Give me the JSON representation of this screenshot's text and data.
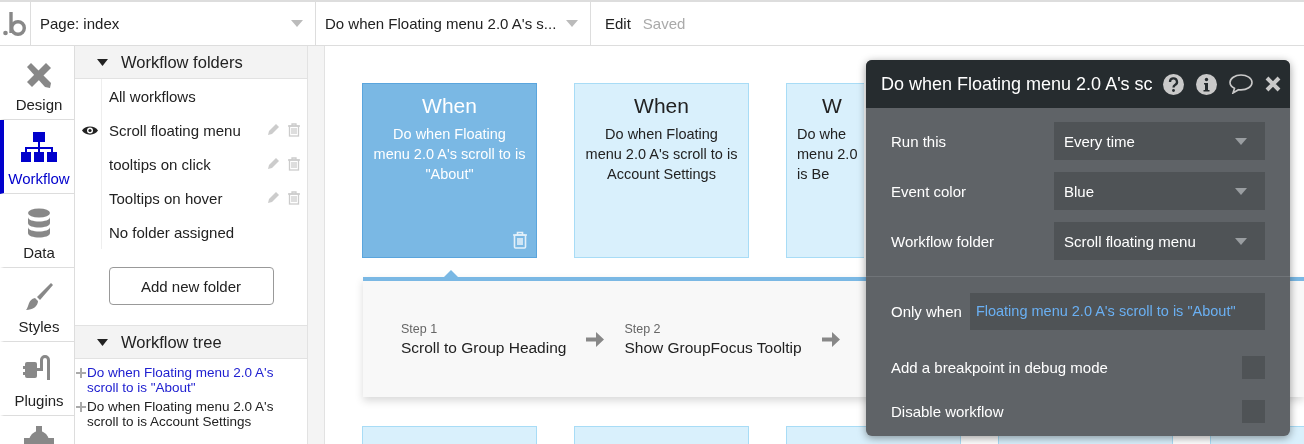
{
  "topbar": {
    "page_select": "Page: index",
    "workflow_select": "Do when Floating menu 2.0 A's s...",
    "edit": "Edit",
    "status": "Saved"
  },
  "nav": [
    {
      "label": "Design",
      "selected": false
    },
    {
      "label": "Workflow",
      "selected": true
    },
    {
      "label": "Data",
      "selected": false
    },
    {
      "label": "Styles",
      "selected": false
    },
    {
      "label": "Plugins",
      "selected": false
    },
    {
      "selected": false
    }
  ],
  "folders": {
    "title": "Workflow folders",
    "expanded": true,
    "items": [
      {
        "label": "All workflows",
        "visible": false,
        "editable": false
      },
      {
        "label": "Scroll floating menu",
        "visible": true,
        "editable": true
      },
      {
        "label": "tooltips on click",
        "visible": false,
        "editable": true
      },
      {
        "label": "Tooltips on hover",
        "visible": false,
        "editable": true
      },
      {
        "label": "No folder assigned",
        "visible": false,
        "editable": false
      }
    ],
    "add_button": "Add new folder"
  },
  "tree": {
    "title": "Workflow tree",
    "expanded": true,
    "items": [
      {
        "label": "Do when Floating menu 2.0 A's scroll to is \"About\"",
        "selected": true
      },
      {
        "label": "Do when Floating menu 2.0 A's scroll to is Account Settings",
        "selected": false
      }
    ]
  },
  "events": [
    {
      "kind": "full",
      "title": "When",
      "description": "Do when Floating menu 2.0 A's scroll to is \"About\"",
      "selected": true
    },
    {
      "kind": "full",
      "title": "When",
      "description": "Do when Floating menu 2.0 A's scroll to is Account Settings",
      "selected": false
    },
    {
      "kind": "partial",
      "title": "W",
      "lines": [
        "Do whe",
        "menu 2.0",
        "is Be"
      ],
      "selected": false
    }
  ],
  "actions": [
    {
      "step": "Step 1",
      "label": "Scroll to Group Heading"
    },
    {
      "step": "Step 2",
      "label": "Show GroupFocus Tooltip"
    }
  ],
  "popup": {
    "title": "Do when Floating menu 2.0 A's sc",
    "fields": [
      {
        "kind": "select",
        "label": "Run this",
        "value": "Every time"
      },
      {
        "kind": "select",
        "label": "Event color",
        "value": "Blue"
      },
      {
        "kind": "select",
        "label": "Workflow folder",
        "value": "Scroll floating menu"
      },
      {
        "kind": "condition",
        "label": "Only when",
        "value": "Floating menu 2.0 A's scroll to is \"About\""
      },
      {
        "kind": "checkbox",
        "label": "Add a breakpoint in debug mode",
        "checked": false
      },
      {
        "kind": "checkbox",
        "label": "Disable workflow",
        "checked": false
      }
    ]
  }
}
